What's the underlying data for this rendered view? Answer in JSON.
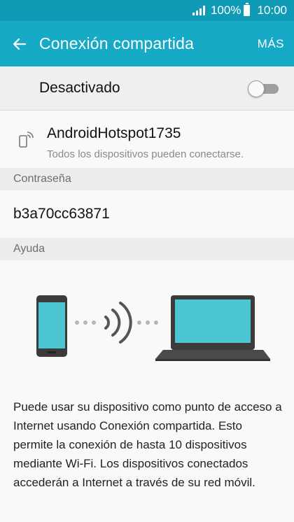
{
  "status_bar": {
    "battery_percent": "100%",
    "time": "10:00",
    "battery_level": 1.0
  },
  "app_bar": {
    "title": "Conexión compartida",
    "more_label": "MÁS",
    "back_icon": "arrow-back-icon"
  },
  "hotspot_toggle": {
    "label": "Desactivado",
    "enabled": false
  },
  "network": {
    "icon": "phone-wifi-icon",
    "ssid": "AndroidHotspot1735",
    "subtitle": "Todos los dispositivos pueden conectarse."
  },
  "password_section": {
    "header": "Contraseña",
    "value": "b3a70cc63871"
  },
  "help_section": {
    "header": "Ayuda",
    "text": "Puede usar su dispositivo como punto de acceso a Internet usando Conexión compartida. Esto permite la conexión de hasta 10 dispositivos mediante Wi-Fi. Los dispositivos conectados accederán a Internet a través de su red móvil."
  },
  "colors": {
    "status_bar": "#0f9ab5",
    "app_bar": "#17aac7",
    "screen_teal": "#4cc7d2",
    "device_dark": "#3b3b3b"
  }
}
